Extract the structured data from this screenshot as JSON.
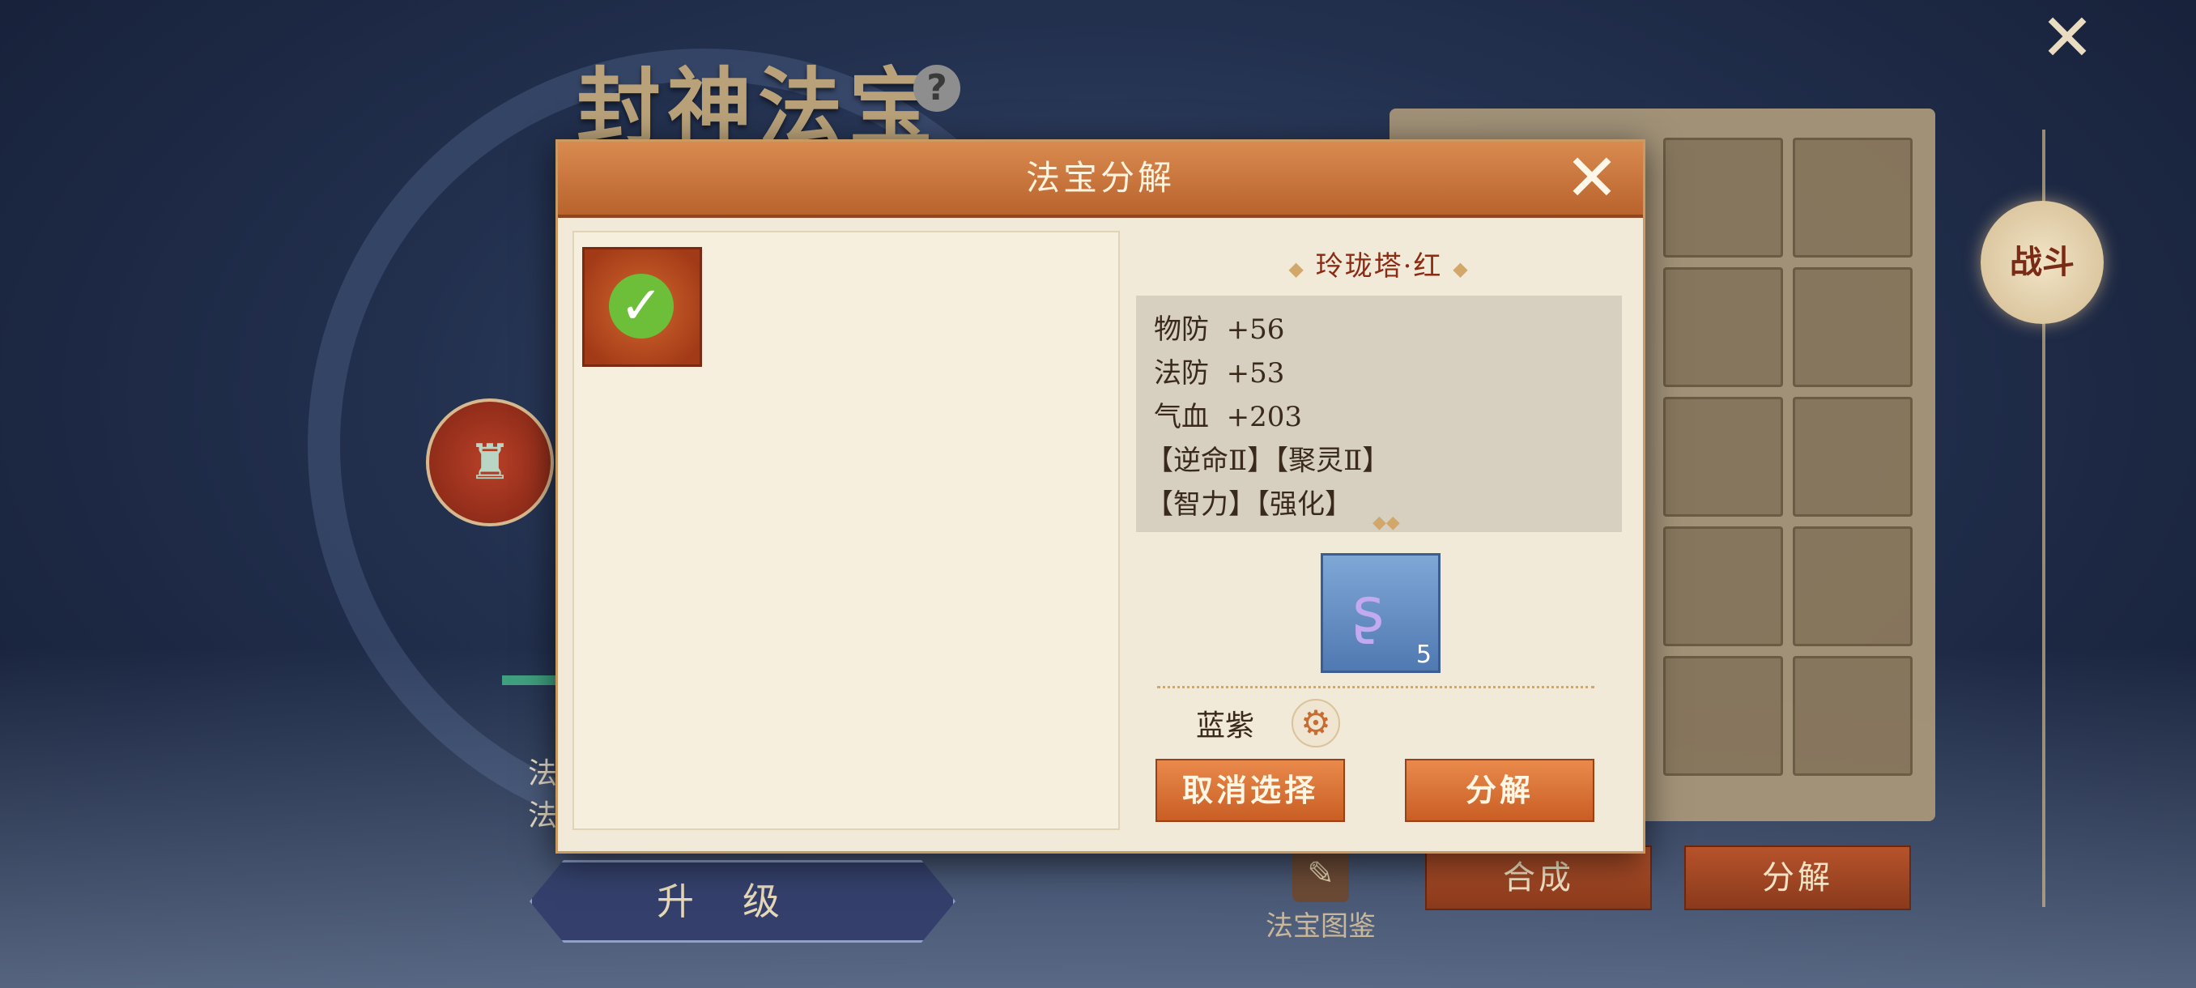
{
  "page": {
    "title": "封神法宝",
    "help_icon": "?",
    "close_icon": "✕",
    "battle_button": "战斗",
    "upgrade_button": "升级",
    "codex_label": "法宝图鉴",
    "compose_button": "合成",
    "decompose_button": "分解",
    "left_glyphs": [
      "法",
      "法"
    ]
  },
  "modal": {
    "title": "法宝分解",
    "close_icon": "✕",
    "selected_item_checked": "✓",
    "detail": {
      "name": "玲珑塔·红",
      "stats": [
        {
          "name": "物防",
          "value": "+56"
        },
        {
          "name": "法防",
          "value": "+53"
        },
        {
          "name": "气血",
          "value": "+203"
        }
      ],
      "effects": [
        "【逆命Ⅱ】【聚灵Ⅱ】",
        "【智力】【强化】"
      ]
    },
    "reward": {
      "icon": "purple-flame-icon",
      "count": "5"
    },
    "quality_filter_label": "蓝紫",
    "cancel_button": "取消选择",
    "decompose_button": "分解"
  }
}
